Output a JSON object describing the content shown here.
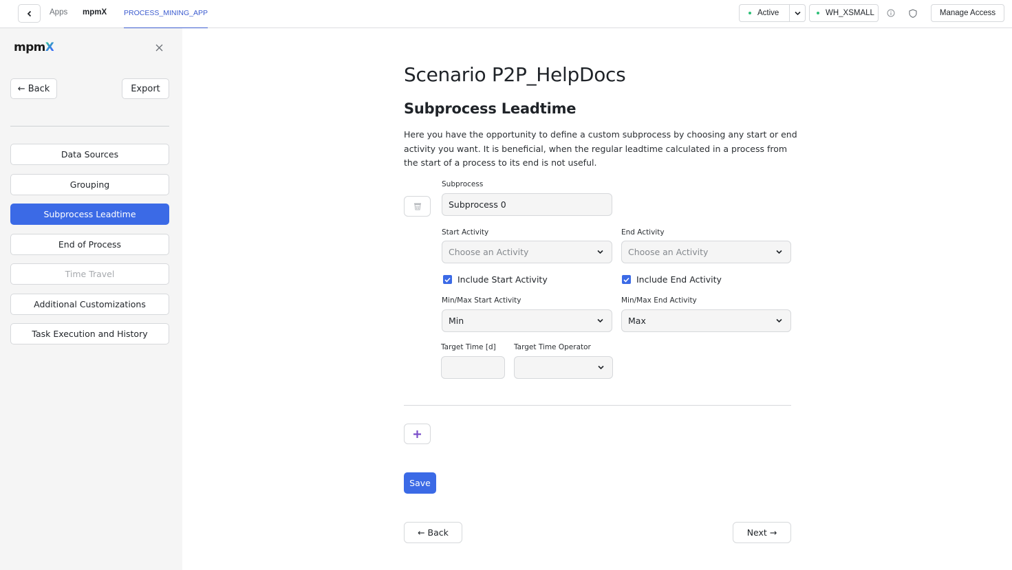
{
  "topbar": {
    "breadcrumb": [
      "Apps",
      "mpmX",
      "PROCESS_MINING_APP"
    ],
    "status_label": "Active",
    "warehouse_label": "WH_XSMALL",
    "manage_access_label": "Manage Access",
    "status_color": "#2dbf77",
    "accent_color": "#3b5bcf"
  },
  "sidebar": {
    "logo_prefix": "mpm",
    "logo_suffix": "X",
    "back_label": "← Back",
    "export_label": "Export",
    "items": [
      {
        "label": "Data Sources",
        "state": "default"
      },
      {
        "label": "Grouping",
        "state": "default"
      },
      {
        "label": "Subprocess Leadtime",
        "state": "active"
      },
      {
        "label": "End of Process",
        "state": "default"
      },
      {
        "label": "Time Travel",
        "state": "disabled"
      },
      {
        "label": "Additional Customizations",
        "state": "default"
      },
      {
        "label": "Task Execution and History",
        "state": "default"
      }
    ]
  },
  "main": {
    "title": "Scenario P2P_HelpDocs",
    "subtitle": "Subprocess Leadtime",
    "description": "Here you have the opportunity to define a custom subprocess by choosing any start or end activity you want. It is beneficial, when the regular leadtime calculated in a process from the start of a process to its end is not useful.",
    "form": {
      "subprocess_label": "Subprocess",
      "subprocess_value": "Subprocess 0",
      "start_activity_label": "Start Activity",
      "start_activity_placeholder": "Choose an Activity",
      "end_activity_label": "End Activity",
      "end_activity_placeholder": "Choose an Activity",
      "include_start_label": "Include Start Activity",
      "include_start_checked": true,
      "include_end_label": "Include End Activity",
      "include_end_checked": true,
      "minmax_start_label": "Min/Max Start Activity",
      "minmax_start_value": "Min",
      "minmax_end_label": "Min/Max End Activity",
      "minmax_end_value": "Max",
      "target_time_label": "Target Time [d]",
      "target_time_value": "",
      "target_operator_label": "Target Time Operator",
      "target_operator_value": ""
    },
    "save_label": "Save",
    "back_label": "← Back",
    "next_label": "Next →",
    "primary_color": "#3b6ae6"
  }
}
